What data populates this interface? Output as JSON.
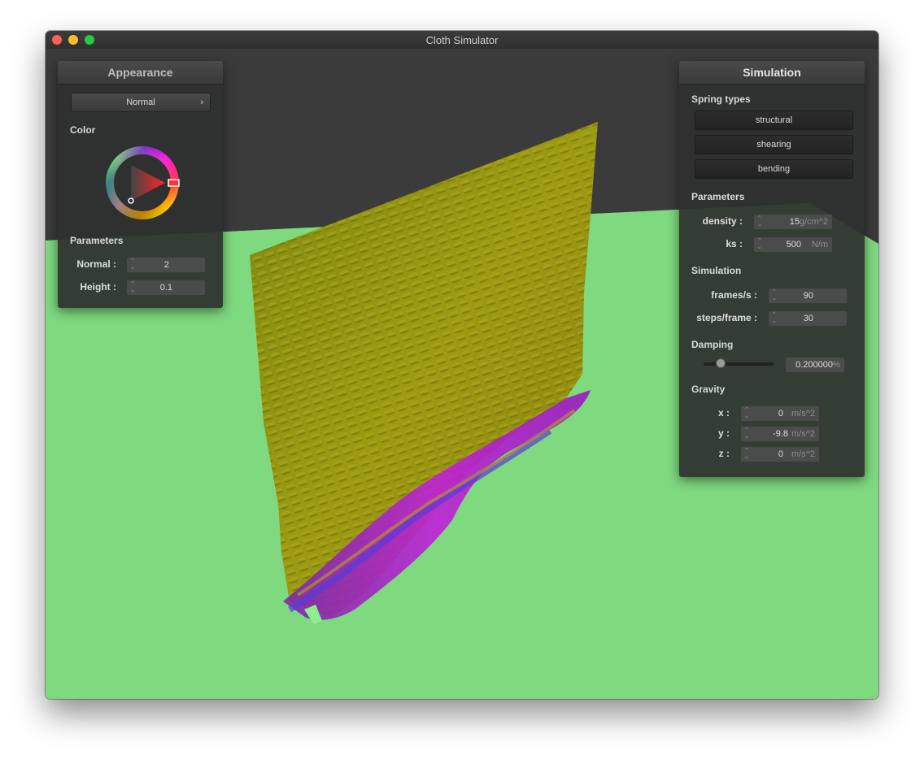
{
  "window": {
    "title": "Cloth Simulator"
  },
  "appearance": {
    "header": "Appearance",
    "shader_dropdown": {
      "value": "Normal"
    },
    "color_label": "Color",
    "parameters_label": "Parameters",
    "normal": {
      "label": "Normal :",
      "value": "2"
    },
    "height": {
      "label": "Height :",
      "value": "0.1"
    },
    "picked_color": "#ff0000"
  },
  "simulation": {
    "header": "Simulation",
    "spring_types_label": "Spring types",
    "spring_buttons": [
      "structural",
      "shearing",
      "bending"
    ],
    "parameters_label": "Parameters",
    "density": {
      "label": "density :",
      "value": "15",
      "unit": "g/cm^2"
    },
    "ks": {
      "label": "ks :",
      "value": "500",
      "unit": "N/m"
    },
    "simulation_label": "Simulation",
    "frames": {
      "label": "frames/s :",
      "value": "90"
    },
    "steps": {
      "label": "steps/frame :",
      "value": "30"
    },
    "damping_label": "Damping",
    "damping": {
      "value": "0.200000",
      "unit": "%",
      "slider_fraction": 0.2
    },
    "gravity_label": "Gravity",
    "gravity": {
      "x": {
        "label": "x :",
        "value": "0",
        "unit": "m/s^2"
      },
      "y": {
        "label": "y :",
        "value": "-9.8",
        "unit": "m/s^2"
      },
      "z": {
        "label": "z :",
        "value": "0",
        "unit": "m/s^2"
      }
    }
  },
  "colors": {
    "floor": "#7fd97f",
    "backdrop": "#3b3b3b",
    "cloth": "#8a9410",
    "cloth_fold": "#a020c0"
  }
}
